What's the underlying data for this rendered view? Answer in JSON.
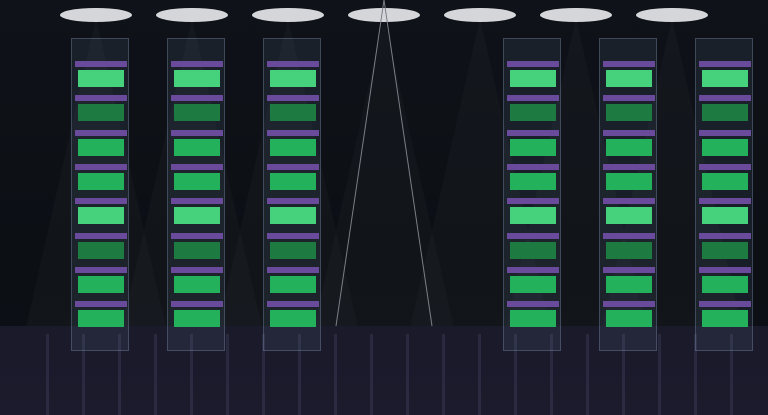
{
  "scene": {
    "ceiling_light_color": "#d4d6da",
    "bar_color": "#6a4a9a",
    "floor_color": "#1c1b2d",
    "rig_line_color": "#7a7e86",
    "towers": [
      {
        "id": "tower-1",
        "rows": [
          "lit",
          "dim",
          "mid",
          "mid",
          "lit",
          "dim",
          "mid",
          "mid"
        ]
      },
      {
        "id": "tower-2",
        "rows": [
          "lit",
          "dim",
          "mid",
          "mid",
          "lit",
          "dim",
          "mid",
          "mid"
        ]
      },
      {
        "id": "tower-3",
        "rows": [
          "lit",
          "dim",
          "mid",
          "mid",
          "lit",
          "dim",
          "mid",
          "mid"
        ]
      },
      {
        "id": "tower-4",
        "rows": [
          "lit",
          "dim",
          "mid",
          "mid",
          "lit",
          "dim",
          "mid",
          "mid"
        ]
      },
      {
        "id": "tower-5",
        "rows": [
          "lit",
          "dim",
          "mid",
          "mid",
          "lit",
          "dim",
          "mid",
          "mid"
        ]
      },
      {
        "id": "tower-6",
        "rows": [
          "lit",
          "dim",
          "mid",
          "mid",
          "lit",
          "dim",
          "mid",
          "mid"
        ]
      }
    ],
    "row_colors": {
      "lit": "#46d17c",
      "mid": "#23b15c",
      "dim": "#1d7a40"
    }
  }
}
